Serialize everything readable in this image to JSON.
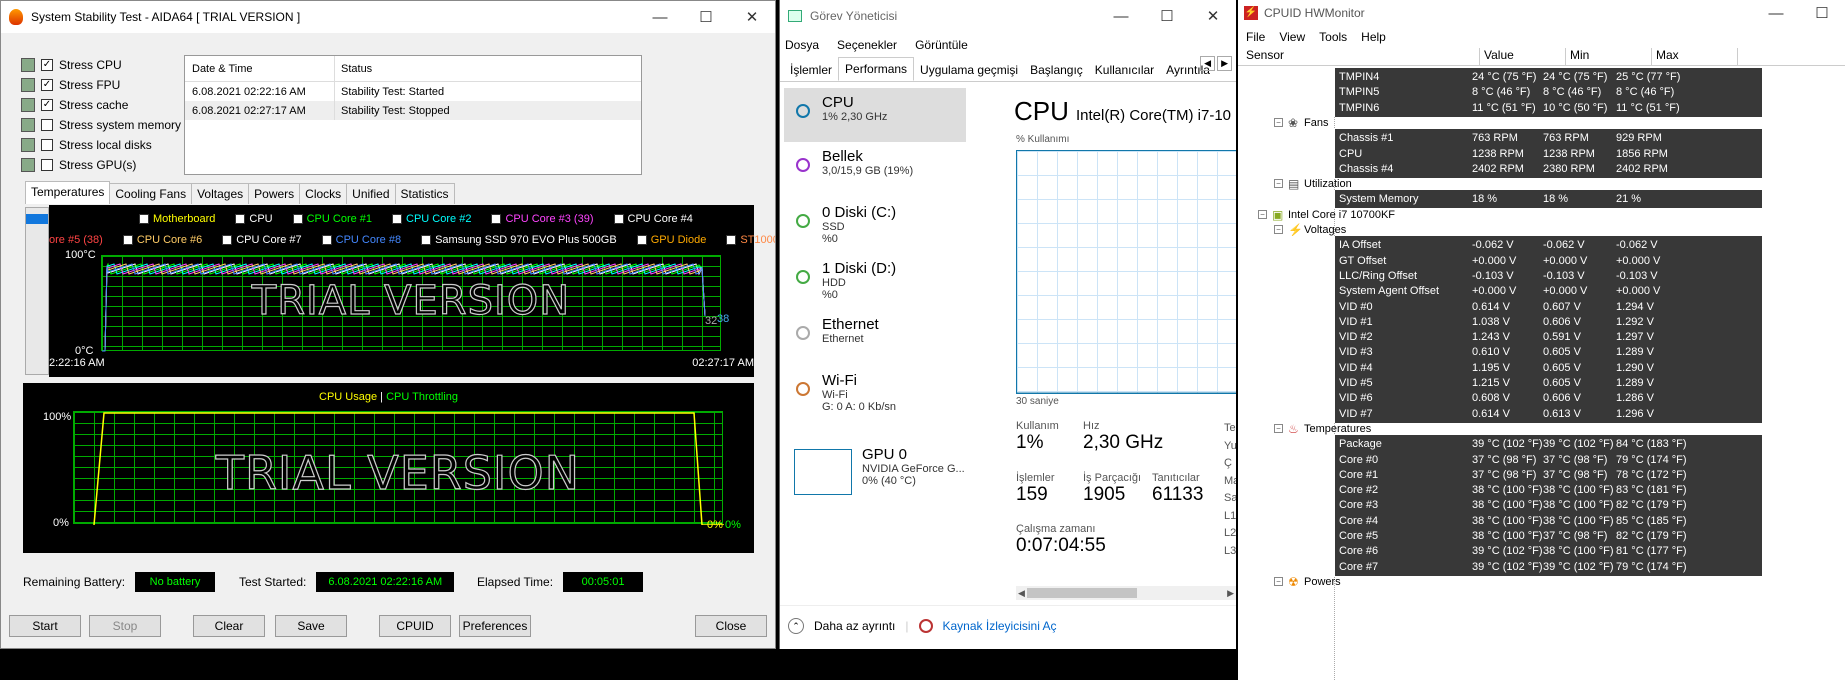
{
  "aida": {
    "title": "System Stability Test - AIDA64  [ TRIAL VERSION ]",
    "stress": [
      {
        "label": "Stress CPU",
        "checked": true
      },
      {
        "label": "Stress FPU",
        "checked": true
      },
      {
        "label": "Stress cache",
        "checked": true
      },
      {
        "label": "Stress system memory",
        "checked": false
      },
      {
        "label": "Stress local disks",
        "checked": false
      },
      {
        "label": "Stress GPU(s)",
        "checked": false
      }
    ],
    "log_headers": [
      "Date & Time",
      "Status"
    ],
    "log": [
      [
        "6.08.2021 02:22:16 AM",
        "Stability Test: Started"
      ],
      [
        "6.08.2021 02:27:17 AM",
        "Stability Test: Stopped"
      ]
    ],
    "tabs": [
      "Temperatures",
      "Cooling Fans",
      "Voltages",
      "Powers",
      "Clocks",
      "Unified",
      "Statistics"
    ],
    "legend1": [
      {
        "t": "Motherboard",
        "c": "#ffff00",
        "chk": false
      },
      {
        "t": "CPU",
        "c": "#ffffff",
        "chk": true
      },
      {
        "t": "CPU Core #1",
        "c": "#00ff00",
        "chk": true
      },
      {
        "t": "CPU Core #2",
        "c": "#00ffff",
        "chk": true
      },
      {
        "t": "CPU Core #3 (39)",
        "c": "#ff44ff",
        "chk": true
      },
      {
        "t": "CPU Core #4",
        "c": "#ffffff",
        "chk": true
      }
    ],
    "legend2": [
      {
        "t": "ore #5 (38)",
        "c": "#ff4444",
        "chk": null
      },
      {
        "t": "CPU Core #6",
        "c": "#ffcc66",
        "chk": true
      },
      {
        "t": "CPU Core #7",
        "c": "#ffffff",
        "chk": true
      },
      {
        "t": "CPU Core #8",
        "c": "#4488ff",
        "chk": true
      },
      {
        "t": "Samsung SSD 970 EVO Plus 500GB",
        "c": "#ffffff",
        "chk": false
      },
      {
        "t": "GPU Diode",
        "c": "#ffaa00",
        "chk": false
      },
      {
        "t": "ST1000DM010",
        "c": "#ff8844",
        "chk": false
      }
    ],
    "y_top": "100°C",
    "y_bot": "0°C",
    "t_start": "2:22:16 AM",
    "t_end": "02:27:17 AM",
    "val_a": "32",
    "val_b": "38",
    "trial": "TRIAL VERSION",
    "chart2_title_a": "CPU Usage",
    "chart2_sep": "|",
    "chart2_title_b": "CPU Throttling",
    "y2_top": "100%",
    "y2_bot": "0%",
    "end2_a": "0%",
    "end2_b": "0%",
    "remaining_label": "Remaining Battery:",
    "remaining": "No battery",
    "started_label": "Test Started:",
    "started": "6.08.2021 02:22:16 AM",
    "elapsed_label": "Elapsed Time:",
    "elapsed": "00:05:01",
    "buttons": {
      "start": "Start",
      "stop": "Stop",
      "clear": "Clear",
      "save": "Save",
      "cpuid": "CPUID",
      "prefs": "Preferences",
      "close": "Close"
    }
  },
  "tm": {
    "title": "Görev Yöneticisi",
    "menu": [
      "Dosya",
      "Seçenekler",
      "Görüntüle"
    ],
    "tabs": [
      "İşlemler",
      "Performans",
      "Uygulama geçmişi",
      "Başlangıç",
      "Kullanıcılar",
      "Ayrıntıla"
    ],
    "side": [
      {
        "name": "CPU",
        "sub1": "1% 2,30 GHz",
        "sub2": "",
        "sub3": "",
        "color": "#17a"
      },
      {
        "name": "Bellek",
        "sub1": "3,0/15,9 GB (19%)",
        "sub2": "",
        "sub3": "",
        "color": "#93c"
      },
      {
        "name": "0 Diski (C:)",
        "sub1": "SSD",
        "sub2": "%0",
        "sub3": "",
        "color": "#4a4"
      },
      {
        "name": "1 Diski (D:)",
        "sub1": "HDD",
        "sub2": "%0",
        "sub3": "",
        "color": "#4a4"
      },
      {
        "name": "Ethernet",
        "sub1": "Ethernet",
        "sub2": "",
        "sub3": "",
        "color": "#aaa"
      },
      {
        "name": "Wi-Fi",
        "sub1": "Wi-Fi",
        "sub2": "G: 0 A: 0 Kb/sn",
        "sub3": "",
        "color": "#c73"
      }
    ],
    "gpu_name": "GPU 0",
    "gpu_sub1": "NVIDIA GeForce G...",
    "gpu_sub2": "0% (40 °C)",
    "cpu_head": "CPU",
    "cpu_model": "Intel(R) Core(TM) i7-10",
    "usage_label": "% Kullanımı",
    "seconds": "30 saniye",
    "s_kull_l": "Kullanım",
    "s_kull": "1%",
    "s_hiz_l": "Hız",
    "s_hiz": "2,30 GHz",
    "s_isl_l": "İşlemler",
    "s_isl": "159",
    "s_par_l": "İş Parçacığı",
    "s_par": "1905",
    "s_tan_l": "Tanıtıcılar",
    "s_tan": "61133",
    "s_up_l": "Çalışma zamanı",
    "s_up": "0:07:04:55",
    "cut": [
      "Te",
      "Yu",
      "Ç",
      "Ma",
      "Sa",
      "L1",
      "L2",
      "L3"
    ],
    "less": "Daha az ayrıntı",
    "monitor": "Kaynak İzleyicisini Aç"
  },
  "hw": {
    "title": "CPUID HWMonitor",
    "menu": [
      "File",
      "View",
      "Tools",
      "Help"
    ],
    "cols": [
      "Sensor",
      "Value",
      "Min",
      "Max"
    ],
    "rows": [
      {
        "k": "d",
        "n": "TMPIN4",
        "v": "24 °C  (75 °F)",
        "mi": "24 °C  (75 °F)",
        "ma": "25 °C  (77 °F)"
      },
      {
        "k": "d",
        "n": "TMPIN5",
        "v": "8 °C  (46 °F)",
        "mi": "8 °C  (46 °F)",
        "ma": "8 °C  (46 °F)"
      },
      {
        "k": "d",
        "n": "TMPIN6",
        "v": "11 °C  (51 °F)",
        "mi": "10 °C  (50 °F)",
        "ma": "11 °C  (51 °F)"
      },
      {
        "k": "g",
        "n": "Fans",
        "lvl": 2
      },
      {
        "k": "d",
        "n": "Chassis #1",
        "v": "763 RPM",
        "mi": "763 RPM",
        "ma": "929 RPM"
      },
      {
        "k": "d",
        "n": "CPU",
        "v": "1238 RPM",
        "mi": "1238 RPM",
        "ma": "1856 RPM"
      },
      {
        "k": "d",
        "n": "Chassis #4",
        "v": "2402 RPM",
        "mi": "2380 RPM",
        "ma": "2402 RPM"
      },
      {
        "k": "g",
        "n": "Utilization",
        "lvl": 2
      },
      {
        "k": "d",
        "n": "System Memory",
        "v": "18 %",
        "mi": "18 %",
        "ma": "21 %"
      },
      {
        "k": "g",
        "n": "Intel Core i7 10700KF",
        "lvl": 1
      },
      {
        "k": "g",
        "n": "Voltages",
        "lvl": 2
      },
      {
        "k": "d",
        "n": "IA Offset",
        "v": "-0.062 V",
        "mi": "-0.062 V",
        "ma": "-0.062 V"
      },
      {
        "k": "d",
        "n": "GT Offset",
        "v": "+0.000 V",
        "mi": "+0.000 V",
        "ma": "+0.000 V"
      },
      {
        "k": "d",
        "n": "LLC/Ring Offset",
        "v": "-0.103 V",
        "mi": "-0.103 V",
        "ma": "-0.103 V"
      },
      {
        "k": "d",
        "n": "System Agent Offset",
        "v": "+0.000 V",
        "mi": "+0.000 V",
        "ma": "+0.000 V"
      },
      {
        "k": "d",
        "n": "VID #0",
        "v": "0.614 V",
        "mi": "0.607 V",
        "ma": "1.294 V"
      },
      {
        "k": "d",
        "n": "VID #1",
        "v": "1.038 V",
        "mi": "0.606 V",
        "ma": "1.292 V"
      },
      {
        "k": "d",
        "n": "VID #2",
        "v": "1.243 V",
        "mi": "0.591 V",
        "ma": "1.297 V"
      },
      {
        "k": "d",
        "n": "VID #3",
        "v": "0.610 V",
        "mi": "0.605 V",
        "ma": "1.289 V"
      },
      {
        "k": "d",
        "n": "VID #4",
        "v": "1.195 V",
        "mi": "0.605 V",
        "ma": "1.290 V"
      },
      {
        "k": "d",
        "n": "VID #5",
        "v": "1.215 V",
        "mi": "0.605 V",
        "ma": "1.289 V"
      },
      {
        "k": "d",
        "n": "VID #6",
        "v": "0.608 V",
        "mi": "0.606 V",
        "ma": "1.286 V"
      },
      {
        "k": "d",
        "n": "VID #7",
        "v": "0.614 V",
        "mi": "0.613 V",
        "ma": "1.296 V"
      },
      {
        "k": "g",
        "n": "Temperatures",
        "lvl": 2
      },
      {
        "k": "d",
        "n": "Package",
        "v": "39 °C  (102 °F)",
        "mi": "39 °C  (102 °F)",
        "ma": "84 °C  (183 °F)"
      },
      {
        "k": "d",
        "n": "Core #0",
        "v": "37 °C  (98 °F)",
        "mi": "37 °C  (98 °F)",
        "ma": "79 °C  (174 °F)"
      },
      {
        "k": "d",
        "n": "Core #1",
        "v": "37 °C  (98 °F)",
        "mi": "37 °C  (98 °F)",
        "ma": "78 °C  (172 °F)"
      },
      {
        "k": "d",
        "n": "Core #2",
        "v": "38 °C  (100 °F)",
        "mi": "38 °C  (100 °F)",
        "ma": "83 °C  (181 °F)"
      },
      {
        "k": "d",
        "n": "Core #3",
        "v": "38 °C  (100 °F)",
        "mi": "38 °C  (100 °F)",
        "ma": "82 °C  (179 °F)"
      },
      {
        "k": "d",
        "n": "Core #4",
        "v": "38 °C  (100 °F)",
        "mi": "38 °C  (100 °F)",
        "ma": "85 °C  (185 °F)"
      },
      {
        "k": "d",
        "n": "Core #5",
        "v": "38 °C  (100 °F)",
        "mi": "37 °C  (98 °F)",
        "ma": "82 °C  (179 °F)"
      },
      {
        "k": "d",
        "n": "Core #6",
        "v": "39 °C  (102 °F)",
        "mi": "38 °C  (100 °F)",
        "ma": "81 °C  (177 °F)"
      },
      {
        "k": "d",
        "n": "Core #7",
        "v": "39 °C  (102 °F)",
        "mi": "39 °C  (102 °F)",
        "ma": "79 °C  (174 °F)"
      },
      {
        "k": "g",
        "n": "Powers",
        "lvl": 2
      }
    ]
  }
}
